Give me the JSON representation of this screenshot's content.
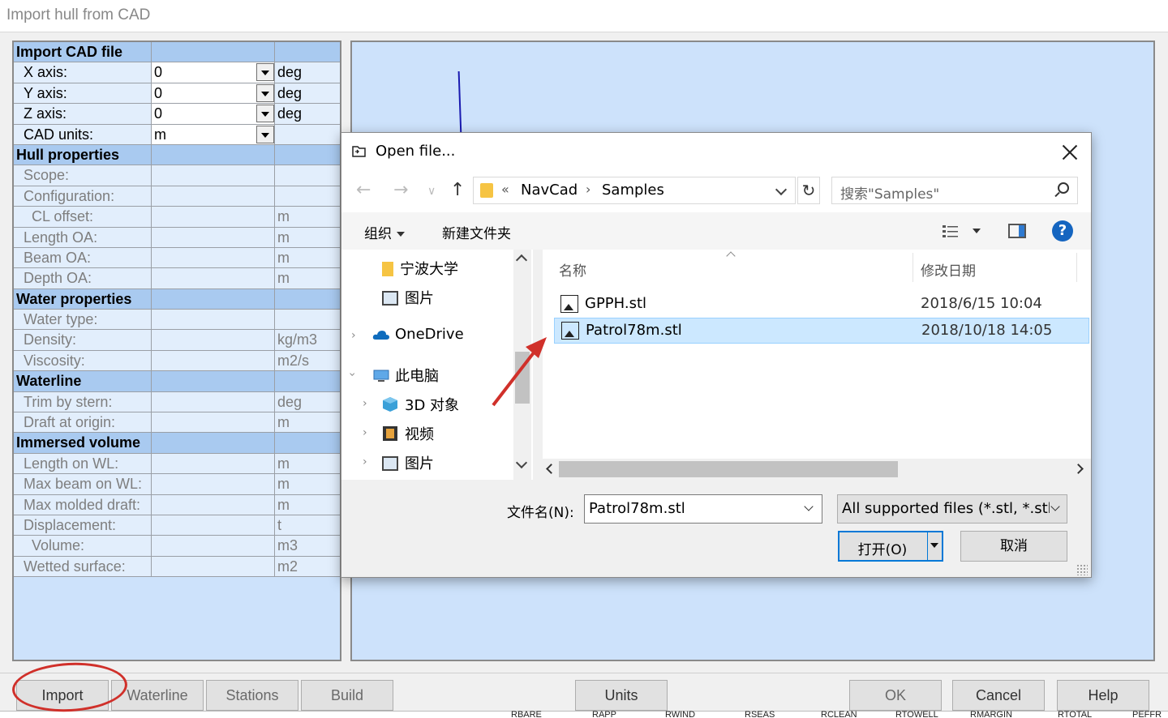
{
  "window": {
    "title": "Import hull from CAD"
  },
  "properties": [
    {
      "kind": "section",
      "label": "Import CAD file"
    },
    {
      "kind": "input",
      "label": "X axis:",
      "value": "0",
      "unit": "deg",
      "dropdown": true
    },
    {
      "kind": "input",
      "label": "Y axis:",
      "value": "0",
      "unit": "deg",
      "dropdown": true
    },
    {
      "kind": "input",
      "label": "Z axis:",
      "value": "0",
      "unit": "deg",
      "dropdown": true
    },
    {
      "kind": "input",
      "label": "CAD units:",
      "value": "m",
      "unit": "",
      "dropdown": true
    },
    {
      "kind": "section",
      "label": "Hull properties"
    },
    {
      "kind": "disabled",
      "label": "Scope:",
      "unit": ""
    },
    {
      "kind": "disabled",
      "label": "Configuration:",
      "unit": ""
    },
    {
      "kind": "disabled",
      "label": "CL offset:",
      "unit": "m",
      "indent": true
    },
    {
      "kind": "disabled",
      "label": "Length OA:",
      "unit": "m"
    },
    {
      "kind": "disabled",
      "label": "Beam OA:",
      "unit": "m"
    },
    {
      "kind": "disabled",
      "label": "Depth OA:",
      "unit": "m"
    },
    {
      "kind": "section",
      "label": "Water properties"
    },
    {
      "kind": "disabled",
      "label": "Water type:",
      "unit": ""
    },
    {
      "kind": "disabled",
      "label": "Density:",
      "unit": "kg/m3"
    },
    {
      "kind": "disabled",
      "label": "Viscosity:",
      "unit": "m2/s"
    },
    {
      "kind": "section",
      "label": "Waterline"
    },
    {
      "kind": "disabled",
      "label": "Trim by stern:",
      "unit": "deg"
    },
    {
      "kind": "disabled",
      "label": "Draft at origin:",
      "unit": "m"
    },
    {
      "kind": "section",
      "label": "Immersed volume"
    },
    {
      "kind": "disabled",
      "label": "Length on WL:",
      "unit": "m"
    },
    {
      "kind": "disabled",
      "label": "Max beam on WL:",
      "unit": "m"
    },
    {
      "kind": "disabled",
      "label": "Max molded draft:",
      "unit": "m"
    },
    {
      "kind": "disabled",
      "label": "Displacement:",
      "unit": "t"
    },
    {
      "kind": "disabled",
      "label": "Volume:",
      "unit": "m3",
      "indent": true
    },
    {
      "kind": "disabled",
      "label": "Wetted surface:",
      "unit": "m2"
    }
  ],
  "bottom_buttons": [
    {
      "label": "Import"
    },
    {
      "label": "Waterline"
    },
    {
      "label": "Stations"
    },
    {
      "label": "Build"
    },
    {
      "label": "Units"
    },
    {
      "label": "OK"
    },
    {
      "label": "Cancel"
    },
    {
      "label": "Help"
    }
  ],
  "ruler_labels": [
    "RBARE",
    "RAPP",
    "RWIND",
    "RSEAS",
    "RCLEAN",
    "RTOWELL",
    "RMARGIN",
    "RTOTAL",
    "PEFFR"
  ],
  "dialog": {
    "title": "Open file...",
    "path": {
      "chevron": "«",
      "segments": [
        "NavCad",
        "Samples"
      ]
    },
    "search_placeholder": "搜索\"Samples\"",
    "toolbar": {
      "organize": "组织",
      "new_folder": "新建文件夹"
    },
    "nav_items": [
      {
        "label": "宁波大学",
        "icon": "folder-icon"
      },
      {
        "label": "图片",
        "icon": "pictures-icon"
      },
      {
        "label": "OneDrive",
        "icon": "onedrive-icon"
      },
      {
        "label": "此电脑",
        "icon": "this-pc-icon"
      },
      {
        "label": "3D 对象",
        "icon": "3d-objects-icon"
      },
      {
        "label": "视频",
        "icon": "videos-icon"
      },
      {
        "label": "图片",
        "icon": "pictures-icon"
      }
    ],
    "columns": {
      "name": "名称",
      "modified": "修改日期"
    },
    "files": [
      {
        "name": "GPPH.stl",
        "modified": "2018/6/15 10:04",
        "selected": false
      },
      {
        "name": "Patrol78m.stl",
        "modified": "2018/10/18 14:05",
        "selected": true
      }
    ],
    "filename_label": "文件名(N):",
    "filename_value": "Patrol78m.stl",
    "filetype_value": "All supported files (*.stl, *.stl",
    "open_label": "打开(O)",
    "cancel_label": "取消"
  },
  "colors": {
    "panel_bg": "#cde2fb",
    "section_bg": "#a9caf0",
    "selection": "#cce8ff",
    "accent": "#0078d7",
    "annotation": "#d0302a"
  }
}
